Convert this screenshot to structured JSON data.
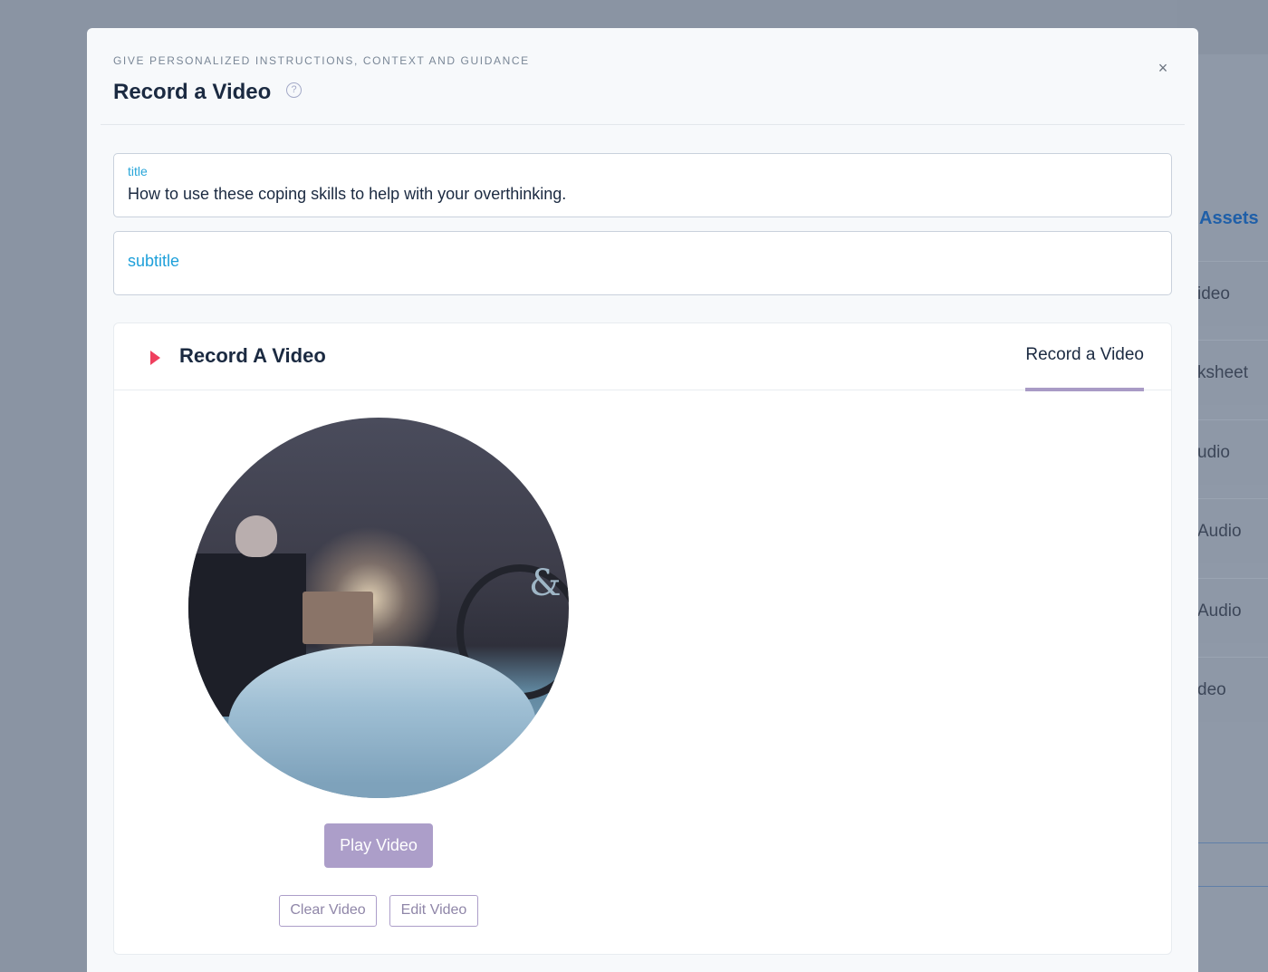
{
  "background": {
    "nav_items": [
      "Assets",
      "ideo",
      "ksheet",
      "udio",
      "Audio",
      "Audio",
      "deo"
    ]
  },
  "modal": {
    "eyebrow": "GIVE PERSONALIZED INSTRUCTIONS, CONTEXT AND GUIDANCE",
    "title": "Record a Video",
    "help_icon": "?",
    "close_icon": "×"
  },
  "fields": {
    "title_label": "title",
    "title_value": "How to use these coping skills to help with your overthinking.",
    "subtitle_placeholder": "subtitle"
  },
  "card": {
    "title": "Record A Video",
    "tab_label": "Record a Video"
  },
  "buttons": {
    "play": "Play Video",
    "clear": "Clear Video",
    "edit": "Edit Video"
  },
  "video": {
    "overlay_glyph": "&"
  },
  "colors": {
    "accent": "#ac9ec9",
    "link": "#2aa6d9",
    "marker": "#ef3f5e"
  }
}
